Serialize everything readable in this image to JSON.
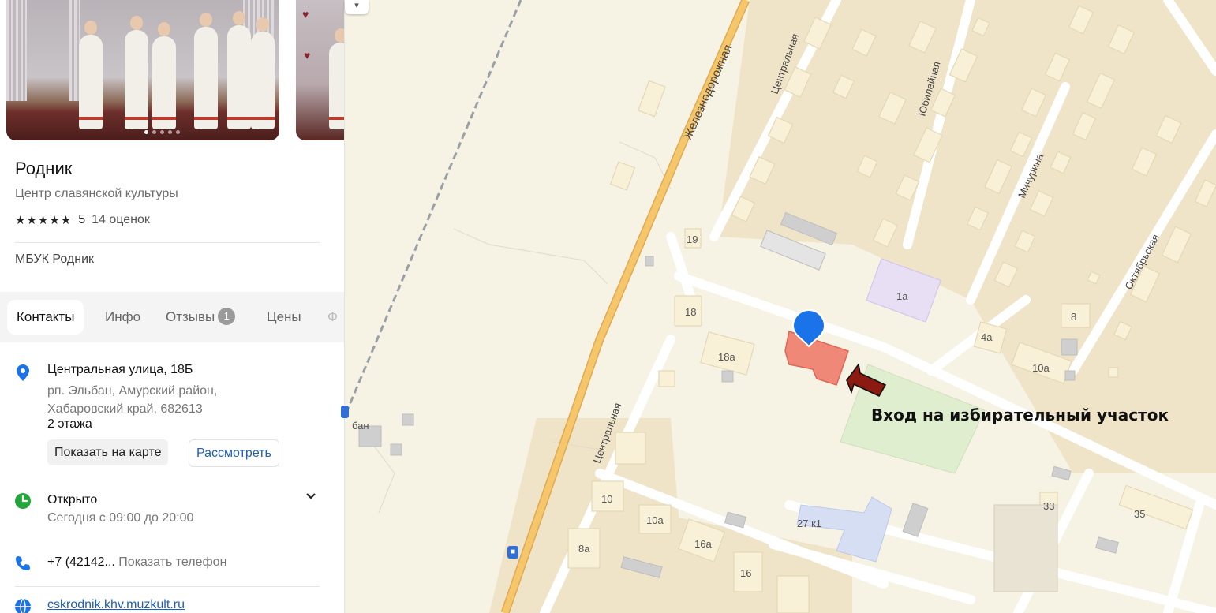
{
  "place": {
    "name": "Родник",
    "category": "Центр славянской культуры",
    "rating_stars": "★★★★★",
    "rating_value": "5",
    "rating_count": "14 оценок",
    "organization": "МБУК Родник"
  },
  "tabs": [
    {
      "label": "Контакты"
    },
    {
      "label": "Инфо"
    },
    {
      "label": "Отзывы",
      "badge": "1"
    },
    {
      "label": "Цены"
    },
    {
      "label": "Ф"
    }
  ],
  "contacts": {
    "street": "Центральная улица, 18Б",
    "region": "рп. Эльбан, Амурский район, Хабаровский край, 682613",
    "floors": "2 этажа",
    "show_on_map": "Показать на карте",
    "view": "Рассмотреть",
    "status": "Открыто",
    "hours": "Сегодня с 09:00 до 20:00",
    "phone": "+7 (42142...",
    "show_phone": "Показать телефон",
    "website": "cskrodnik.khv.muzkult.ru"
  },
  "map": {
    "streets": {
      "zheleznodorozhnaya": "Железнодорожная",
      "tsentralnaya": "Центральная",
      "yubileynaya": "Юбилейная",
      "michurina": "Мичурина",
      "oktyabrskaya": "Октябрьская"
    },
    "houses": [
      "19",
      "18",
      "18а",
      "1а",
      "4а",
      "8",
      "10а",
      "10",
      "10а",
      "16а",
      "8а",
      "16",
      "27 к1",
      "33",
      "35"
    ],
    "station_fragment": "бан",
    "annotation": "Вход на избирательный участок"
  },
  "colors": {
    "target_building": "#f08878",
    "pin": "#1a73e8",
    "arrow": "#8b1a10",
    "road_main": "#f6c66a",
    "green_area": "#dfeecf"
  },
  "icons": [
    "location-pin-icon",
    "clock-icon",
    "phone-icon",
    "globe-icon",
    "chevron-down-icon",
    "bus-stop-icon",
    "star-icon"
  ]
}
